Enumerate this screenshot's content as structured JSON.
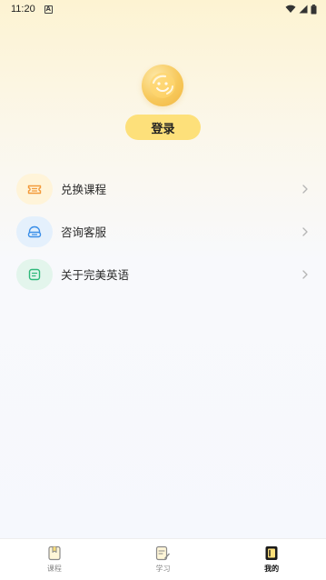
{
  "status_bar": {
    "time": "11:20",
    "notification_icon": "a-box-icon",
    "icons": [
      "wifi-icon",
      "signal-icon",
      "battery-icon"
    ]
  },
  "profile": {
    "avatar_icon": "smiley-avatar-icon",
    "login_label": "登录"
  },
  "menu": {
    "items": [
      {
        "label": "兑换课程",
        "icon": "ticket-icon",
        "icon_bg": "#fff4d9",
        "icon_color": "#f39a3a"
      },
      {
        "label": "咨询客服",
        "icon": "headset-icon",
        "icon_bg": "#e4f0fc",
        "icon_color": "#3b8fe8"
      },
      {
        "label": "关于完美英语",
        "icon": "info-card-icon",
        "icon_bg": "#e3f5ec",
        "icon_color": "#2fb87a"
      }
    ]
  },
  "tab_bar": {
    "tabs": [
      {
        "label": "课程",
        "icon": "course-bookmark-icon",
        "active": false
      },
      {
        "label": "学习",
        "icon": "study-note-icon",
        "active": false
      },
      {
        "label": "我的",
        "icon": "profile-book-icon",
        "active": true
      }
    ]
  },
  "colors": {
    "accent": "#fde07a",
    "background_top": "#fdf3d2",
    "background_bottom": "#f6f8fd"
  }
}
